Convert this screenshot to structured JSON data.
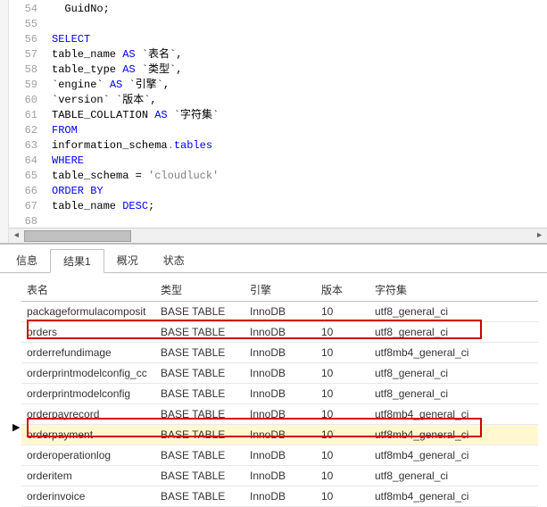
{
  "editor": {
    "lines": [
      {
        "n": 54,
        "segs": [
          {
            "t": "  GuidNo;",
            "c": "id"
          }
        ]
      },
      {
        "n": 55,
        "segs": []
      },
      {
        "n": 56,
        "segs": [
          {
            "t": "SELECT",
            "c": "kw"
          }
        ]
      },
      {
        "n": 57,
        "segs": [
          {
            "t": "table_name ",
            "c": "id"
          },
          {
            "t": "AS",
            "c": "kw"
          },
          {
            "t": " `表名`,",
            "c": "id"
          }
        ]
      },
      {
        "n": 58,
        "segs": [
          {
            "t": "table_type ",
            "c": "id"
          },
          {
            "t": "AS",
            "c": "kw"
          },
          {
            "t": " `类型`,",
            "c": "id"
          }
        ]
      },
      {
        "n": 59,
        "segs": [
          {
            "t": "`engine` ",
            "c": "id"
          },
          {
            "t": "AS",
            "c": "kw"
          },
          {
            "t": " `引擎`,",
            "c": "id"
          }
        ]
      },
      {
        "n": 60,
        "segs": [
          {
            "t": "`version` `版本`,",
            "c": "id"
          }
        ]
      },
      {
        "n": 61,
        "segs": [
          {
            "t": "TABLE_COLLATION ",
            "c": "id"
          },
          {
            "t": "AS",
            "c": "kw"
          },
          {
            "t": " `字符集`",
            "c": "id"
          }
        ]
      },
      {
        "n": 62,
        "segs": [
          {
            "t": "FROM",
            "c": "kw"
          }
        ]
      },
      {
        "n": 63,
        "segs": [
          {
            "t": "information_schema",
            "c": "id"
          },
          {
            "t": ".",
            "c": "dot"
          },
          {
            "t": "tables",
            "c": "tbl"
          }
        ]
      },
      {
        "n": 64,
        "segs": [
          {
            "t": "WHERE",
            "c": "kw"
          }
        ]
      },
      {
        "n": 65,
        "segs": [
          {
            "t": "table_schema = ",
            "c": "id"
          },
          {
            "t": "'cloudluck'",
            "c": "str"
          }
        ]
      },
      {
        "n": 66,
        "segs": [
          {
            "t": "ORDER BY",
            "c": "kw"
          }
        ]
      },
      {
        "n": 67,
        "segs": [
          {
            "t": "table_name ",
            "c": "id"
          },
          {
            "t": "DESC",
            "c": "kw"
          },
          {
            "t": ";",
            "c": "id"
          }
        ]
      },
      {
        "n": 68,
        "segs": []
      }
    ]
  },
  "tabs": {
    "items": [
      {
        "label": "信息",
        "active": false
      },
      {
        "label": "结果1",
        "active": true
      },
      {
        "label": "概况",
        "active": false
      },
      {
        "label": "状态",
        "active": false
      }
    ]
  },
  "grid": {
    "columns": [
      "表名",
      "类型",
      "引擎",
      "版本",
      "字符集"
    ],
    "rows": [
      {
        "name": "packageformulacomposit",
        "type": "BASE TABLE",
        "engine": "InnoDB",
        "ver": "10",
        "coll": "utf8_general_ci",
        "hl": false,
        "cur": false
      },
      {
        "name": "orders",
        "type": "BASE TABLE",
        "engine": "InnoDB",
        "ver": "10",
        "coll": "utf8_general_ci",
        "hl": true,
        "cur": false
      },
      {
        "name": "orderrefundimage",
        "type": "BASE TABLE",
        "engine": "InnoDB",
        "ver": "10",
        "coll": "utf8mb4_general_ci",
        "hl": false,
        "cur": false
      },
      {
        "name": "orderprintmodelconfig_cc",
        "type": "BASE TABLE",
        "engine": "InnoDB",
        "ver": "10",
        "coll": "utf8_general_ci",
        "hl": false,
        "cur": false
      },
      {
        "name": "orderprintmodelconfig",
        "type": "BASE TABLE",
        "engine": "InnoDB",
        "ver": "10",
        "coll": "utf8_general_ci",
        "hl": false,
        "cur": false
      },
      {
        "name": "orderpayrecord",
        "type": "BASE TABLE",
        "engine": "InnoDB",
        "ver": "10",
        "coll": "utf8mb4_general_ci",
        "hl": false,
        "cur": false
      },
      {
        "name": "orderpayment",
        "type": "BASE TABLE",
        "engine": "InnoDB",
        "ver": "10",
        "coll": "utf8mb4_general_ci",
        "hl": true,
        "cur": true
      },
      {
        "name": "orderoperationlog",
        "type": "BASE TABLE",
        "engine": "InnoDB",
        "ver": "10",
        "coll": "utf8mb4_general_ci",
        "hl": false,
        "cur": false
      },
      {
        "name": "orderitem",
        "type": "BASE TABLE",
        "engine": "InnoDB",
        "ver": "10",
        "coll": "utf8_general_ci",
        "hl": false,
        "cur": false
      },
      {
        "name": "orderinvoice",
        "type": "BASE TABLE",
        "engine": "InnoDB",
        "ver": "10",
        "coll": "utf8mb4_general_ci",
        "hl": false,
        "cur": false
      }
    ]
  }
}
